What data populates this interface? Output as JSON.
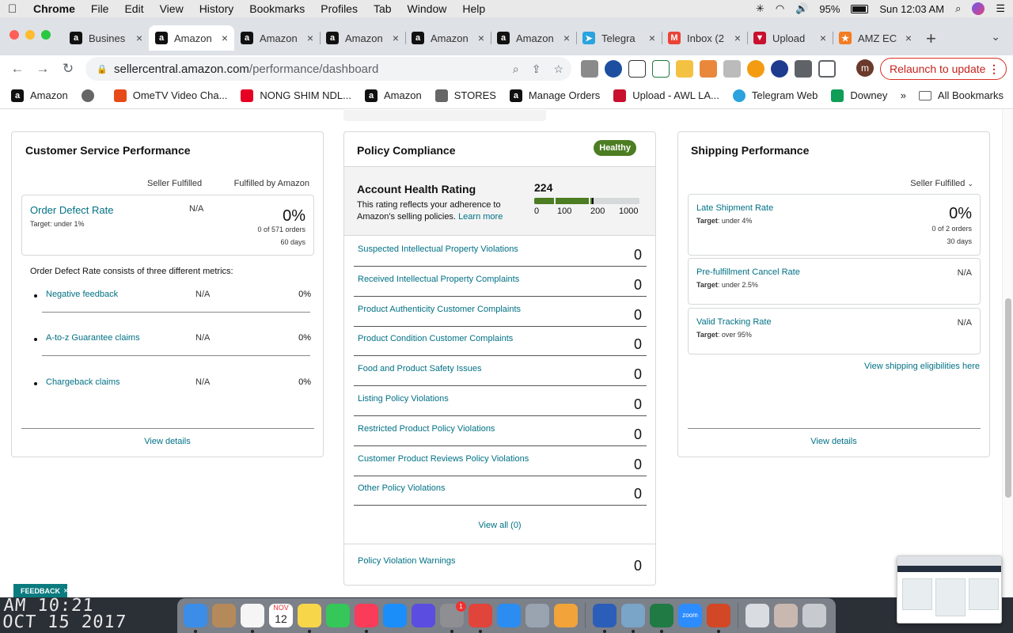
{
  "menubar": {
    "app": "Chrome",
    "items": [
      "File",
      "Edit",
      "View",
      "History",
      "Bookmarks",
      "Profiles",
      "Tab",
      "Window",
      "Help"
    ],
    "battery": "95%",
    "clock": "Sun 12:03 AM"
  },
  "tabs": [
    {
      "title": "Busines",
      "favicon": "amazon",
      "color": "#111"
    },
    {
      "title": "Amazon",
      "favicon": "amazon",
      "color": "#111"
    },
    {
      "title": "Amazon",
      "favicon": "amazon",
      "color": "#111"
    },
    {
      "title": "Amazon",
      "favicon": "amazon",
      "color": "#111"
    },
    {
      "title": "Amazon",
      "favicon": "amazon",
      "color": "#111"
    },
    {
      "title": "Amazon",
      "favicon": "amazon",
      "color": "#111"
    },
    {
      "title": "Telegra",
      "favicon": "telegram",
      "color": "#2aa3df"
    },
    {
      "title": "Inbox (2",
      "favicon": "gmail",
      "color": "#ea4335"
    },
    {
      "title": "Upload",
      "favicon": "awl",
      "color": "#c8102e"
    },
    {
      "title": "AMZ EC",
      "favicon": "amz",
      "color": "#f47b20"
    }
  ],
  "toolbar": {
    "url_host": "sellercentral.amazon.com",
    "url_path": "/performance/dashboard",
    "profile_initial": "m",
    "relaunch": "Relaunch to update"
  },
  "bookmarks": [
    {
      "label": "Amazon",
      "icon": "amazon-icon",
      "color": "#111"
    },
    {
      "label": "",
      "icon": "globe-icon",
      "color": "#666"
    },
    {
      "label": "OmeTV Video Cha...",
      "icon": "ometv-icon",
      "color": "#e64a19"
    },
    {
      "label": "NONG SHIM NDL...",
      "icon": "pinterest-icon",
      "color": "#e60023"
    },
    {
      "label": "Amazon",
      "icon": "amazon-icon",
      "color": "#111"
    },
    {
      "label": "STORES",
      "icon": "folder-icon",
      "color": "#666"
    },
    {
      "label": "Manage Orders",
      "icon": "amazon-icon",
      "color": "#111"
    },
    {
      "label": "Upload - AWL LA...",
      "icon": "awl-icon",
      "color": "#c8102e"
    },
    {
      "label": "Telegram Web",
      "icon": "telegram-icon",
      "color": "#2aa3df"
    },
    {
      "label": "Downey",
      "icon": "sheets-icon",
      "color": "#0f9d58"
    }
  ],
  "bookmarks_right": {
    "more": "»",
    "all": "All Bookmarks"
  },
  "customer_service": {
    "title": "Customer Service Performance",
    "col_seller": "Seller Fulfilled",
    "col_fba": "Fulfilled by Amazon",
    "odr": {
      "name": "Order Defect Rate",
      "target_label": "Target",
      "target": ": under 1%",
      "seller": "N/A",
      "value": "0%",
      "orders": "0 of 571 orders",
      "days": "60 days"
    },
    "intro": "Order Defect Rate consists of three different metrics:",
    "metrics": [
      {
        "name": "Negative feedback",
        "seller": "N/A",
        "fba": "0%"
      },
      {
        "name": "A-to-z Guarantee claims",
        "seller": "N/A",
        "fba": "0%"
      },
      {
        "name": "Chargeback claims",
        "seller": "N/A",
        "fba": "0%"
      }
    ],
    "view_details": "View details"
  },
  "policy": {
    "title": "Policy Compliance",
    "status": "Healthy",
    "status_color": "#4c7d22",
    "ahr_title": "Account Health Rating",
    "ahr_desc": "This rating reflects your adherence to Amazon's selling policies.",
    "learn_more": "Learn more",
    "score": "224",
    "score_value": 224,
    "ticks": [
      "0",
      "100",
      "200",
      "1000"
    ],
    "rows": [
      {
        "name": "Suspected Intellectual Property Violations",
        "value": "0"
      },
      {
        "name": "Received Intellectual Property Complaints",
        "value": "0"
      },
      {
        "name": "Product Authenticity Customer Complaints",
        "value": "0"
      },
      {
        "name": "Product Condition Customer Complaints",
        "value": "0"
      },
      {
        "name": "Food and Product Safety Issues",
        "value": "0"
      },
      {
        "name": "Listing Policy Violations",
        "value": "0"
      },
      {
        "name": "Restricted Product Policy Violations",
        "value": "0"
      },
      {
        "name": "Customer Product Reviews Policy Violations",
        "value": "0"
      },
      {
        "name": "Other Policy Violations",
        "value": "0"
      }
    ],
    "view_all": "View all (0)",
    "warnings": {
      "name": "Policy Violation Warnings",
      "value": "0"
    }
  },
  "shipping": {
    "title": "Shipping Performance",
    "filter": "Seller Fulfilled",
    "late": {
      "name": "Late Shipment Rate",
      "target_label": "Target",
      "target": ": under 4%",
      "value": "0%",
      "orders": "0 of 2 orders",
      "days": "30 days"
    },
    "cancel": {
      "name": "Pre-fulfillment Cancel Rate",
      "target_label": "Target",
      "target": ": under 2.5%",
      "value": "N/A"
    },
    "tracking": {
      "name": "Valid Tracking Rate",
      "target_label": "Target",
      "target": ": over 95%",
      "value": "N/A"
    },
    "eligibility": "View shipping eligibilities here",
    "view_details": "View details"
  },
  "feedback": {
    "label": "FEEDBACK",
    "close": "×"
  },
  "wallpaper_clock": {
    "line1": "AM 10:21",
    "line2": "OCT 15 2017"
  },
  "dock": {
    "calendar_month": "NOV",
    "calendar_day": "12",
    "settings_badge": "1",
    "zoom_label": "zoom",
    "apps": [
      {
        "name": "finder",
        "color": "#3b8de8"
      },
      {
        "name": "contacts",
        "color": "#b58a5a"
      },
      {
        "name": "reminders",
        "color": "#f5f5f5"
      },
      {
        "name": "calendar",
        "color": "#ffffff"
      },
      {
        "name": "notes",
        "color": "#f7d64a"
      },
      {
        "name": "facetime",
        "color": "#35c759"
      },
      {
        "name": "music",
        "color": "#fa3c5a"
      },
      {
        "name": "app-store",
        "color": "#1c8ef9"
      },
      {
        "name": "siri",
        "color": "#5b4de0"
      },
      {
        "name": "system-preferences",
        "color": "#8e8e93"
      },
      {
        "name": "chrome",
        "color": "#e0443a"
      },
      {
        "name": "safari",
        "color": "#2b8df2"
      },
      {
        "name": "launchpad",
        "color": "#9aa3b0"
      },
      {
        "name": "photos",
        "color": "#f2a33a"
      },
      {
        "name": "word",
        "color": "#2b5eb8"
      },
      {
        "name": "preview",
        "color": "#7aa4c8"
      },
      {
        "name": "excel",
        "color": "#1f7a44"
      },
      {
        "name": "zoom",
        "color": "#2d8cff"
      },
      {
        "name": "powerpoint",
        "color": "#d24726"
      },
      {
        "name": "documents",
        "color": "#d9dde2"
      },
      {
        "name": "downloads",
        "color": "#c9b8b0"
      },
      {
        "name": "trash",
        "color": "#c7cbd0"
      }
    ]
  }
}
